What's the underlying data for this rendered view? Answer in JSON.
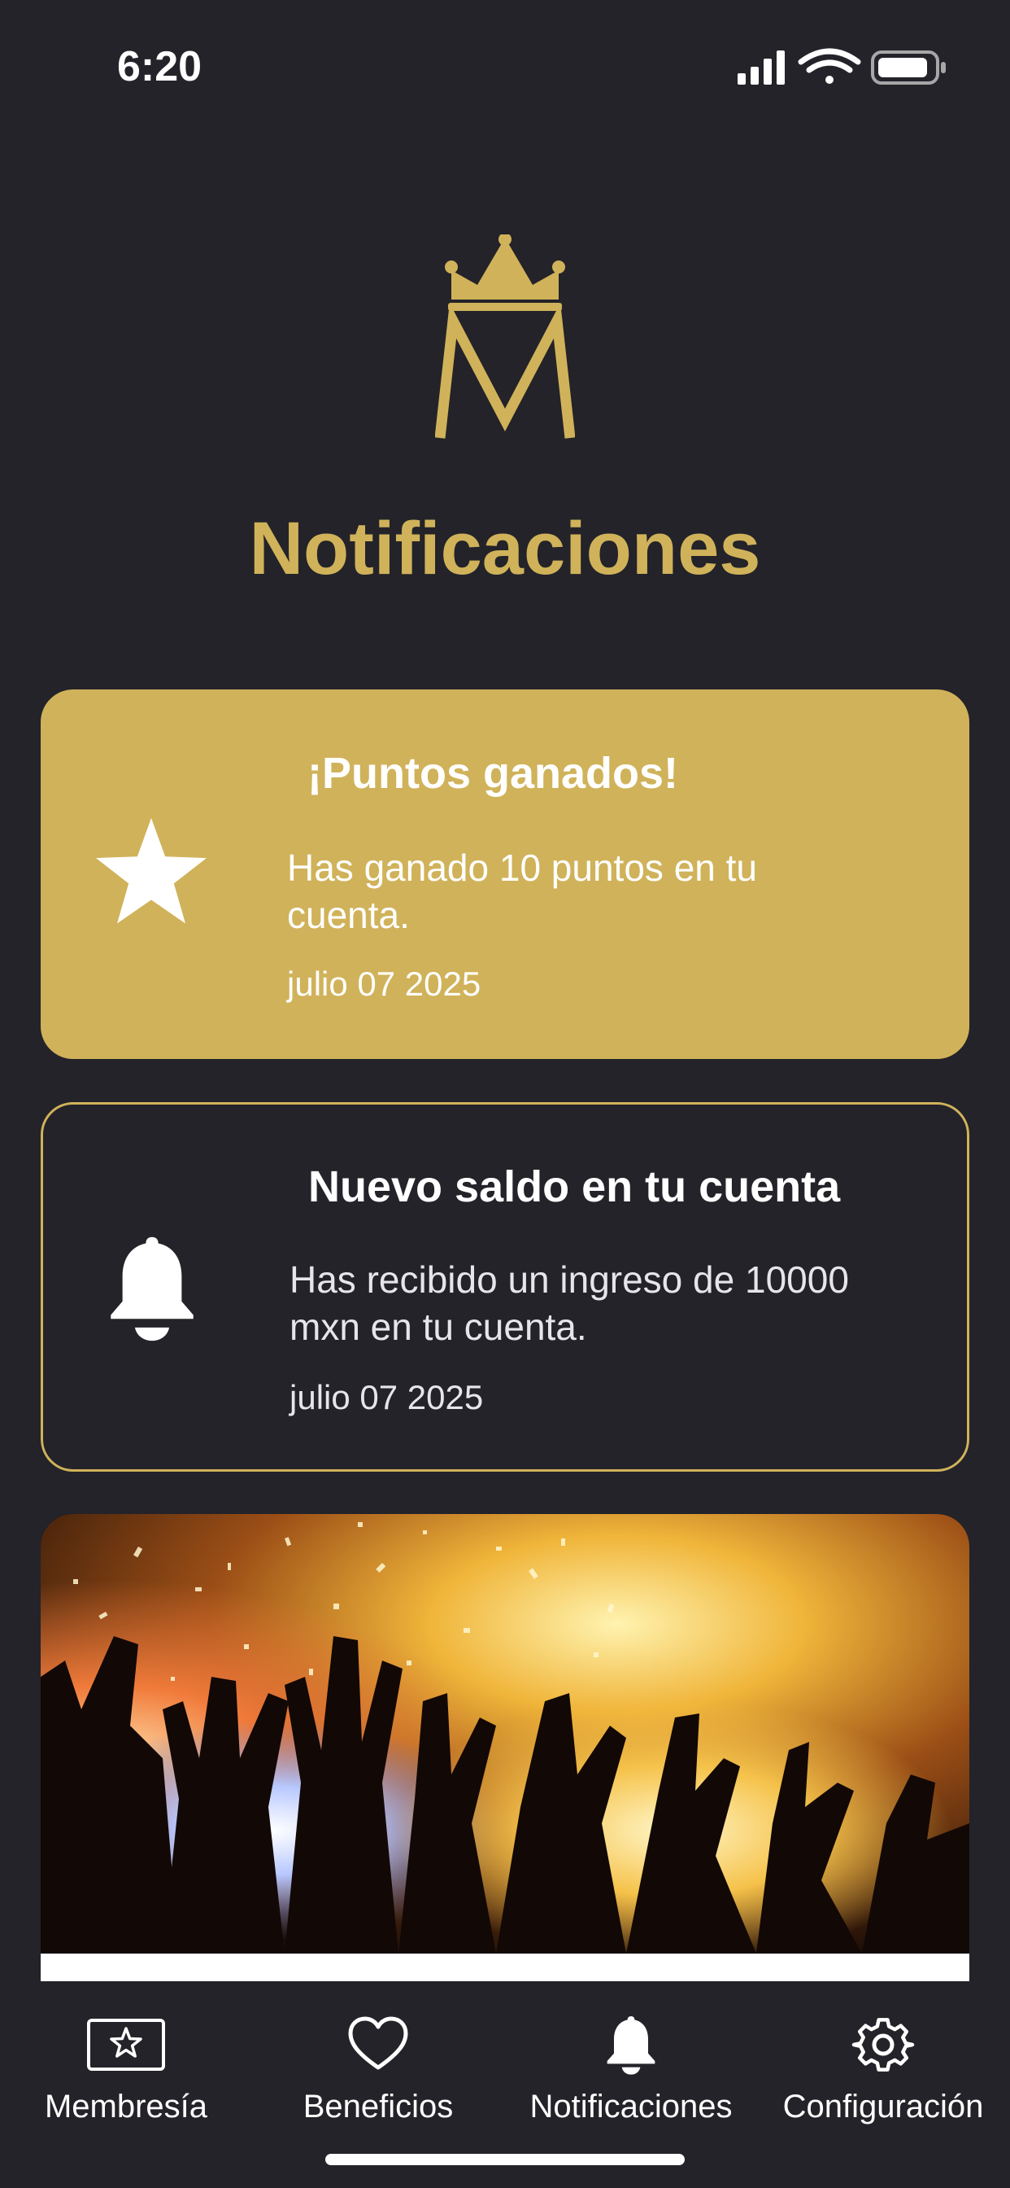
{
  "status_bar": {
    "time": "6:20",
    "icons": [
      "signal-icon",
      "wifi-icon",
      "battery-icon"
    ]
  },
  "header": {
    "logo_icon": "crowned-m-logo-icon",
    "title": "Notificaciones"
  },
  "notifications": [
    {
      "icon": "star-icon",
      "title": "¡Puntos ganados!",
      "body": "Has ganado 10 puntos en tu cuenta.",
      "date": "julio 07 2025",
      "style": "filled"
    },
    {
      "icon": "bell-icon",
      "title": "Nuevo saldo en tu cuenta",
      "body": "Has recibido un ingreso de 10000 mxn en tu cuenta.",
      "date": "julio 07 2025",
      "style": "outline"
    }
  ],
  "promo": {
    "image": "concert-crowd-confetti-photo"
  },
  "tabbar": {
    "items": [
      {
        "label": "Membresía",
        "icon": "membership-card-star-icon"
      },
      {
        "label": "Beneficios",
        "icon": "heart-icon"
      },
      {
        "label": "Notificaciones",
        "icon": "bell-icon",
        "active": true
      },
      {
        "label": "Configuración",
        "icon": "gear-icon"
      }
    ]
  },
  "colors": {
    "background": "#232329",
    "accent_gold": "#d0b25a",
    "text": "#ffffff"
  }
}
